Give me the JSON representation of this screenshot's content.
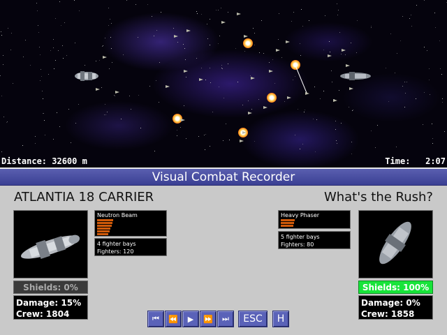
{
  "hud": {
    "distance": "Distance: 32600 m",
    "time": "Time:   2:07"
  },
  "panel": {
    "title": "Visual Combat Recorder"
  },
  "left_ship": {
    "name": "ATLANTIA 18 CARRIER",
    "weapon": "Neutron Beam",
    "weapon_level": 0.9,
    "bays": "4 fighter bays",
    "fighters": "Fighters: 120",
    "shields": "Shields: 0%",
    "damage": "Damage: 15%",
    "crew": "Crew: 1804"
  },
  "right_ship": {
    "name": "What's the Rush?",
    "weapon": "Heavy Phaser",
    "weapon_level": 0.4,
    "bays": "5 fighter bays",
    "fighters": "Fighters: 80",
    "shields": "Shields: 100%",
    "damage": "Damage: 0%",
    "crew": "Crew: 1858"
  },
  "controls": {
    "first": "⏮",
    "rewind": "⏪",
    "play": "▶",
    "forward": "⏩",
    "last": "⏭",
    "esc": "ESC",
    "help": "H"
  },
  "colors": {
    "title_bar": "#4a4fa3",
    "shield_full": "#18e43a",
    "weapon_bar": "#d05a0a"
  }
}
